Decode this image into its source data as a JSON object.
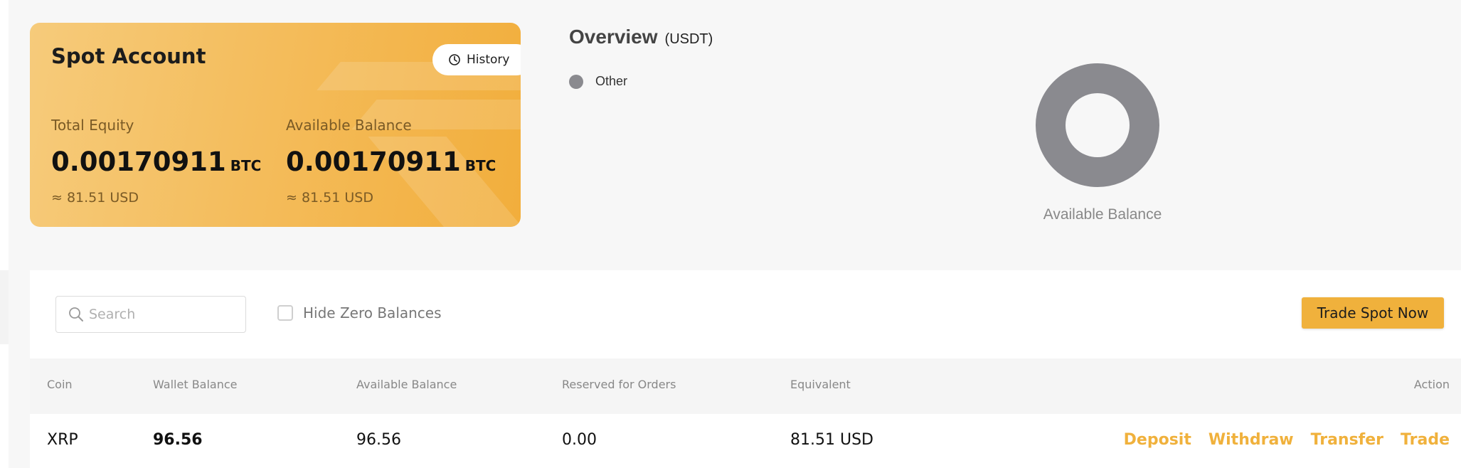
{
  "spot_account": {
    "title": "Spot Account",
    "history_label": "History",
    "total_equity": {
      "label": "Total Equity",
      "value": "0.00170911",
      "unit": "BTC",
      "usd": "≈ 81.51 USD"
    },
    "available_balance": {
      "label": "Available Balance",
      "value": "0.00170911",
      "unit": "BTC",
      "usd": "≈ 81.51 USD"
    },
    "colors": {
      "card_start": "#f6cb7b",
      "card_end": "#f2ae3c"
    }
  },
  "overview": {
    "title": "Overview",
    "unit": "(USDT)",
    "legend": [
      {
        "label": "Other",
        "color": "#8a8a8f"
      }
    ],
    "donut_label": "Available Balance",
    "donut_share_other": 1.0
  },
  "toolbar": {
    "search_placeholder": "Search",
    "hide_zero_label": "Hide Zero Balances",
    "hide_zero_checked": false,
    "trade_button_label": "Trade Spot Now"
  },
  "table": {
    "headers": {
      "coin": "Coin",
      "wallet_balance": "Wallet Balance",
      "available_balance": "Available Balance",
      "reserved": "Reserved for Orders",
      "equivalent": "Equivalent",
      "action": "Action"
    },
    "rows": [
      {
        "coin": "XRP",
        "wallet_balance": "96.56",
        "available_balance": "96.56",
        "reserved": "0.00",
        "equivalent": "81.51 USD",
        "actions": [
          "Deposit",
          "Withdraw",
          "Transfer",
          "Trade"
        ]
      }
    ]
  },
  "accent_color": "#f0b13c"
}
